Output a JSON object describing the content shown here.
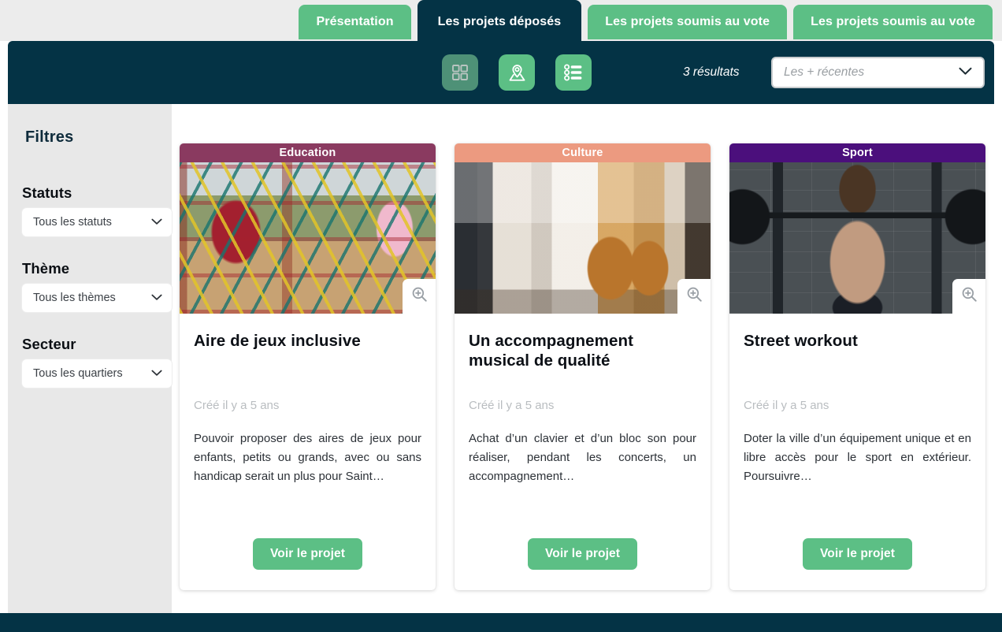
{
  "tabs": [
    {
      "label": "Présentation",
      "active": false
    },
    {
      "label": "Les projets déposés",
      "active": true
    },
    {
      "label": "Les projets soumis au vote",
      "active": false
    },
    {
      "label": "Les projets soumis au vote",
      "active": false
    }
  ],
  "toolbar": {
    "views": [
      {
        "name": "grid-view",
        "icon": "grid-icon",
        "selected": true
      },
      {
        "name": "map-view",
        "icon": "map-pin-icon",
        "selected": false
      },
      {
        "name": "list-view",
        "icon": "list-icon",
        "selected": false
      }
    ],
    "results_count": "3 résultats",
    "sort": {
      "value": "Les + récentes",
      "placeholder": "Les + récentes",
      "chevron": "chevron-down-icon"
    }
  },
  "sidebar": {
    "title": "Filtres",
    "groups": [
      {
        "label": "Statuts",
        "value": "Tous les statuts"
      },
      {
        "label": "Thème",
        "value": "Tous les thèmes"
      },
      {
        "label": "Secteur",
        "value": "Tous les quartiers"
      }
    ]
  },
  "cards": [
    {
      "category": "Education",
      "category_color": "#8a3a60",
      "title": "Aire de jeux inclusive",
      "date": "Créé il y a 5 ans",
      "description": "Pouvoir proposer des aires de jeux pour enfants, petits ou grands, avec ou sans handicap serait un plus pour Saint…",
      "cta": "Voir le projet",
      "zoom_icon": "magnifier-plus-icon"
    },
    {
      "category": "Culture",
      "category_color": "#ec9a80",
      "title": "Un accompagnement musical de qualité",
      "date": "Créé il y a 5 ans",
      "description": "Achat d’un clavier et d’un bloc son pour réaliser, pendant les concerts, un accompagnement…",
      "cta": "Voir le projet",
      "zoom_icon": "magnifier-plus-icon"
    },
    {
      "category": "Sport",
      "category_color": "#4b0f7c",
      "title": "Street workout",
      "date": "Créé il y a 5 ans",
      "description": "Doter la ville d’un équipement unique et en libre accès pour le sport en extérieur. Poursuivre…",
      "cta": "Voir le projet",
      "zoom_icon": "magnifier-plus-icon"
    }
  ],
  "colors": {
    "brand_dark": "#043345",
    "brand_green": "#5cbf85",
    "brand_green_muted": "#4e9177",
    "sidebar_bg": "#e8e8e8",
    "page_bg": "#ffffff"
  }
}
